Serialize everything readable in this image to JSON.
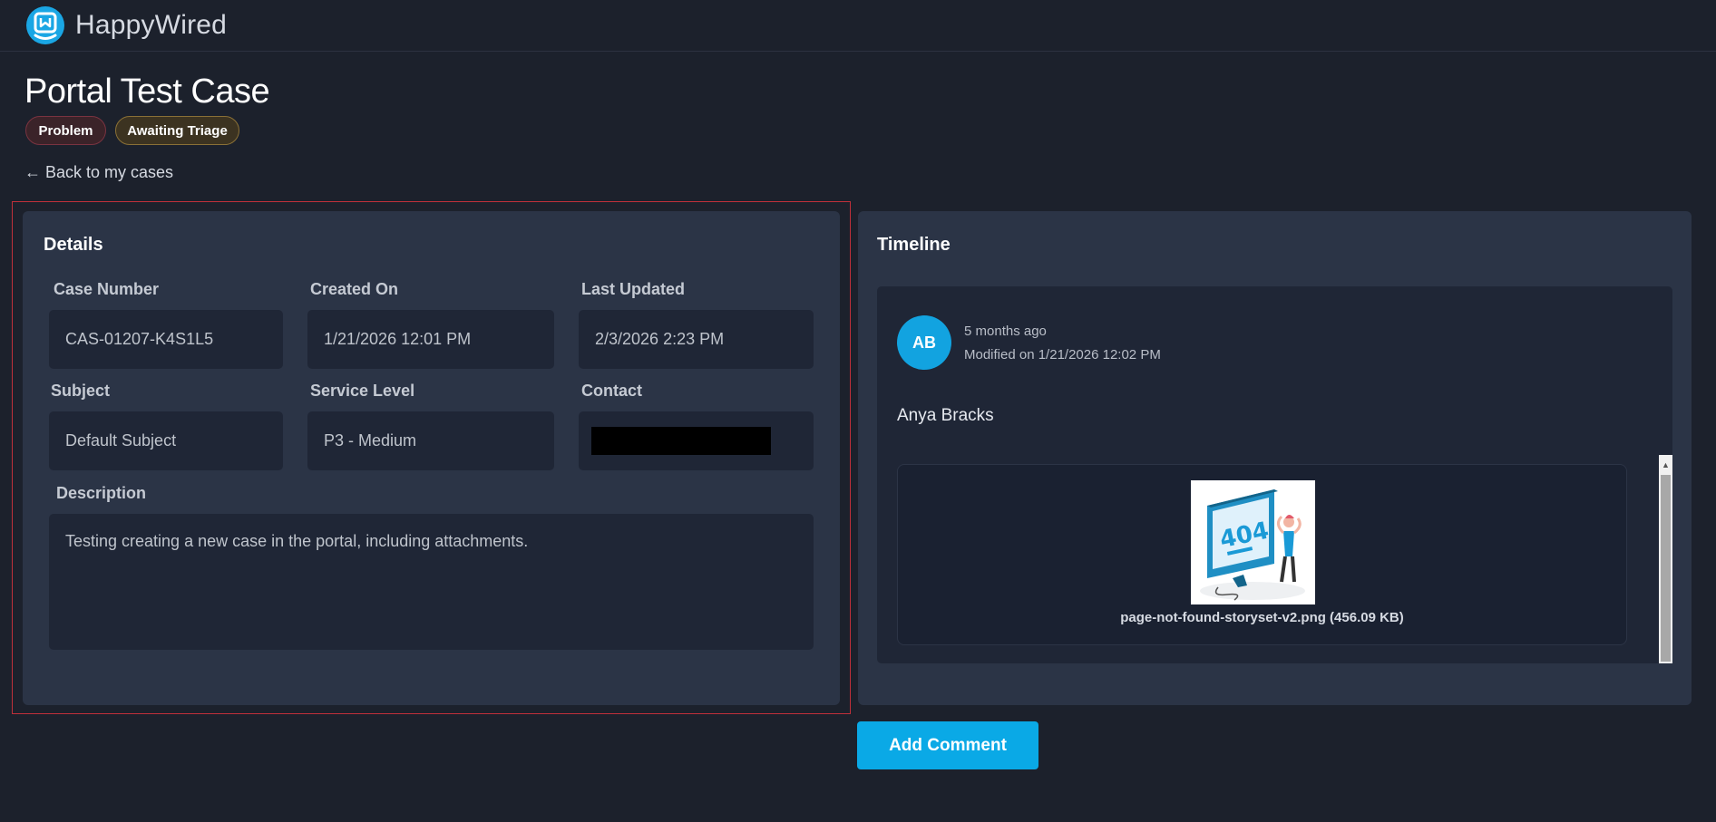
{
  "app": {
    "brand": "HappyWired"
  },
  "case": {
    "title": "Portal Test Case",
    "badges": {
      "type": "Problem",
      "status": "Awaiting Triage"
    },
    "back_link": "← Back to my cases"
  },
  "details": {
    "title": "Details",
    "case_number": {
      "label": "Case Number",
      "value": "CAS-01207-K4S1L5"
    },
    "created_on": {
      "label": "Created On",
      "value": "1/21/2026 12:01 PM"
    },
    "last_updated": {
      "label": "Last Updated",
      "value": "2/3/2026 2:23 PM"
    },
    "subject": {
      "label": "Subject",
      "value": "Default Subject"
    },
    "service_level": {
      "label": "Service Level",
      "value": "P3 - Medium"
    },
    "contact": {
      "label": "Contact"
    },
    "description": {
      "label": "Description",
      "value": "Testing creating a new case in the portal, including attachments."
    }
  },
  "timeline": {
    "title": "Timeline",
    "entry": {
      "avatar_initials": "AB",
      "relative_time": "5 months ago",
      "modified": "Modified on 1/21/2026 12:02 PM",
      "author": "Anya Bracks",
      "attachment_name": "page-not-found-storyset-v2.png (456.09 KB)"
    }
  },
  "actions": {
    "add_comment": "Add Comment"
  },
  "colors": {
    "accent": "#0aa9e6",
    "background": "#1c212c",
    "panel": "#2b3446",
    "field": "#1f2636"
  },
  "icons": {
    "logo": "happywired-logo-icon",
    "attachment_thumbnail": "404-error-illustration-icon"
  }
}
